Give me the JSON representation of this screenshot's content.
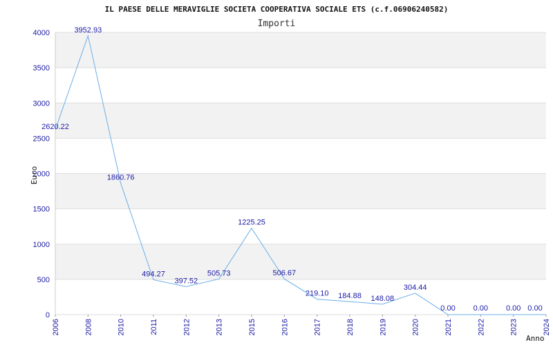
{
  "chart_data": {
    "type": "line",
    "title": "IL PAESE DELLE MERAVIGLIE SOCIETA COOPERATIVA SOCIALE ETS (c.f.06906240582)",
    "subtitle": "Importi",
    "xlabel": "Anno",
    "ylabel": "Euro",
    "ylim": [
      0,
      4000
    ],
    "yticks": [
      0,
      500,
      1000,
      1500,
      2000,
      2500,
      3000,
      3500,
      4000
    ],
    "grid": "horizontal bands",
    "categories": [
      "2006",
      "2008",
      "2010",
      "2011",
      "2012",
      "2013",
      "2015",
      "2016",
      "2017",
      "2018",
      "2019",
      "2020",
      "2021",
      "2022",
      "2023",
      "2024"
    ],
    "series": [
      {
        "values": [
          2620.22,
          3952.93,
          1860.76,
          494.27,
          397.52,
          505.73,
          1225.25,
          506.67,
          219.1,
          184.88,
          148.08,
          304.44,
          0.0,
          0.0,
          0.0,
          0.0
        ],
        "labels": [
          "2620.22",
          "3952.93",
          "1860.76",
          "494.27",
          "397.52",
          "505.73",
          "1225.25",
          "506.67",
          "219.10",
          "184.88",
          "148.08",
          "304.44",
          "0.00",
          "0.00",
          "0.00",
          "0.00"
        ],
        "color": "#6aaee8"
      }
    ],
    "colors": {
      "band": "#f2f2f2",
      "gridline": "#dddddd",
      "tick_text": "#1a1aa6"
    }
  }
}
